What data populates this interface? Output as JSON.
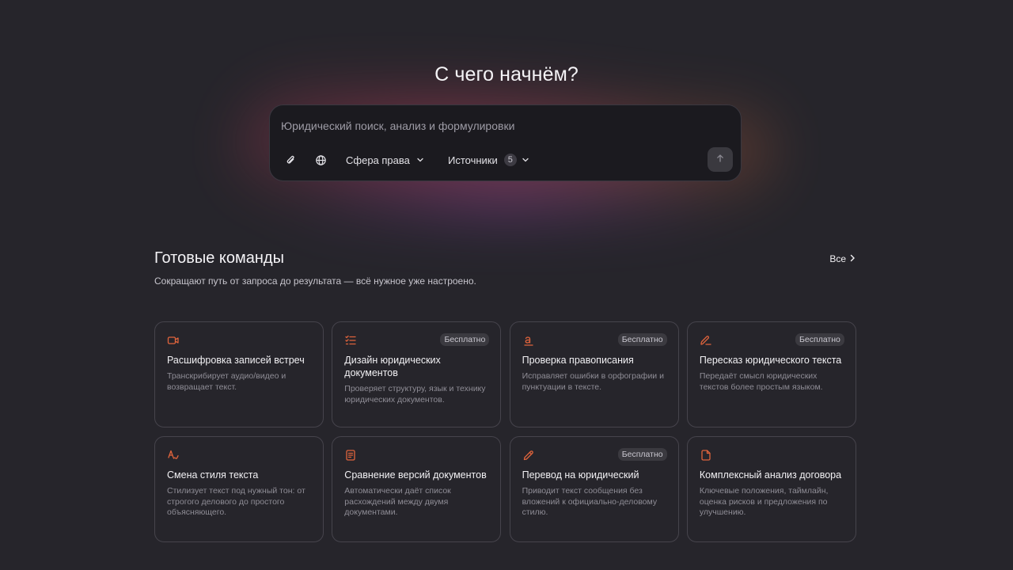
{
  "hero": {
    "title": "С чего начнём?"
  },
  "search": {
    "placeholder": "Юридический поиск, анализ и формулировки",
    "value": "",
    "attach_icon": "paperclip-icon",
    "web_icon": "globe-icon",
    "law_area_label": "Сфера права",
    "sources_label": "Источники",
    "sources_count": "5",
    "send_icon": "arrow-up-icon"
  },
  "commands": {
    "title": "Готовые команды",
    "subtitle": "Сокращают путь от запроса до результата — всё нужное уже настроено.",
    "all_label": "Все",
    "accent_color": "#e0643c",
    "cards": [
      {
        "icon": "video-camera-icon",
        "title": "Расшифровка записей встреч",
        "desc": "Транскрибирует аудио/видео и возвращает текст.",
        "badge": ""
      },
      {
        "icon": "checklist-icon",
        "title": "Дизайн юридических документов",
        "desc": "Проверяет структуру, язык и технику юридических документов.",
        "badge": "Бесплатно"
      },
      {
        "icon": "spellcheck-icon",
        "title": "Проверка правописания",
        "desc": "Исправляет ошибки в орфографии и пунктуации в тексте.",
        "badge": "Бесплатно"
      },
      {
        "icon": "pen-icon",
        "title": "Пересказ юридического текста",
        "desc": "Передаёт смысл юридических текстов более простым языком.",
        "badge": "Бесплатно"
      },
      {
        "icon": "text-style-icon",
        "title": "Смена стиля текста",
        "desc": "Стилизует текст под нужный тон: от строгого делового до простого объясняющего.",
        "badge": ""
      },
      {
        "icon": "document-icon",
        "title": "Сравнение версий документов",
        "desc": "Автоматически даёт список расхождений между двумя документами.",
        "badge": ""
      },
      {
        "icon": "pencil-icon",
        "title": "Перевод на юридический",
        "desc": "Приводит текст сообщения без вложений к официально-деловому стилю.",
        "badge": "Бесплатно"
      },
      {
        "icon": "file-icon",
        "title": "Комплексный анализ договора",
        "desc": "Ключевые положения, таймлайн, оценка рисков и предложения по улучшению.",
        "badge": ""
      }
    ]
  }
}
